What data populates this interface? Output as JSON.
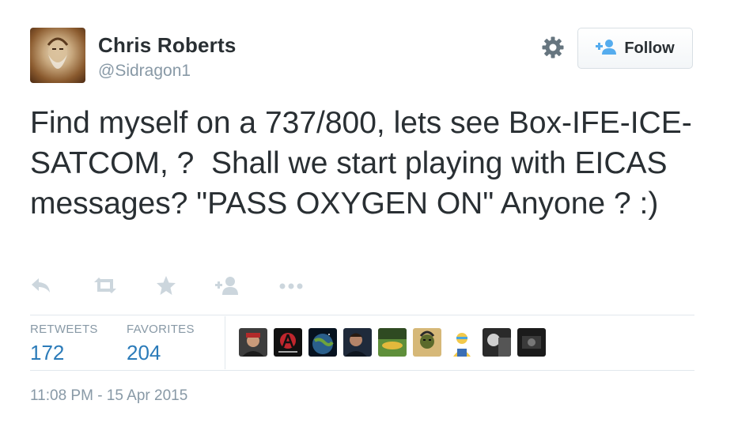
{
  "author": {
    "name": "Chris Roberts",
    "handle": "@Sidragon1"
  },
  "follow_button": {
    "label": "Follow"
  },
  "tweet": {
    "text": "Find myself on a 737/800, lets see Box-IFE-ICE-SATCOM, ?  Shall we start playing with EICAS messages? \"PASS OXYGEN ON\" Anyone ? :)"
  },
  "actions": [
    {
      "icon": "reply-icon"
    },
    {
      "icon": "retweet-icon"
    },
    {
      "icon": "favorite-star-icon"
    },
    {
      "icon": "follow-user-icon"
    },
    {
      "icon": "more-dots-icon"
    }
  ],
  "stats": {
    "retweets": {
      "label": "RETWEETS",
      "value": "172"
    },
    "favorites": {
      "label": "FAVORITES",
      "value": "204"
    }
  },
  "favoriters": [
    {
      "icon": "user-avatar"
    },
    {
      "icon": "user-avatar"
    },
    {
      "icon": "user-avatar"
    },
    {
      "icon": "user-avatar"
    },
    {
      "icon": "user-avatar"
    },
    {
      "icon": "user-avatar"
    },
    {
      "icon": "user-avatar"
    },
    {
      "icon": "user-avatar"
    },
    {
      "icon": "user-avatar"
    }
  ],
  "timestamp": "11:08 PM - 15 Apr 2015",
  "colors": {
    "text": "#292f33",
    "muted": "#8899a6",
    "link_blue": "#2b7bb9",
    "follow_icon_blue": "#55acee",
    "icon_gray": "#ccd6dd"
  }
}
